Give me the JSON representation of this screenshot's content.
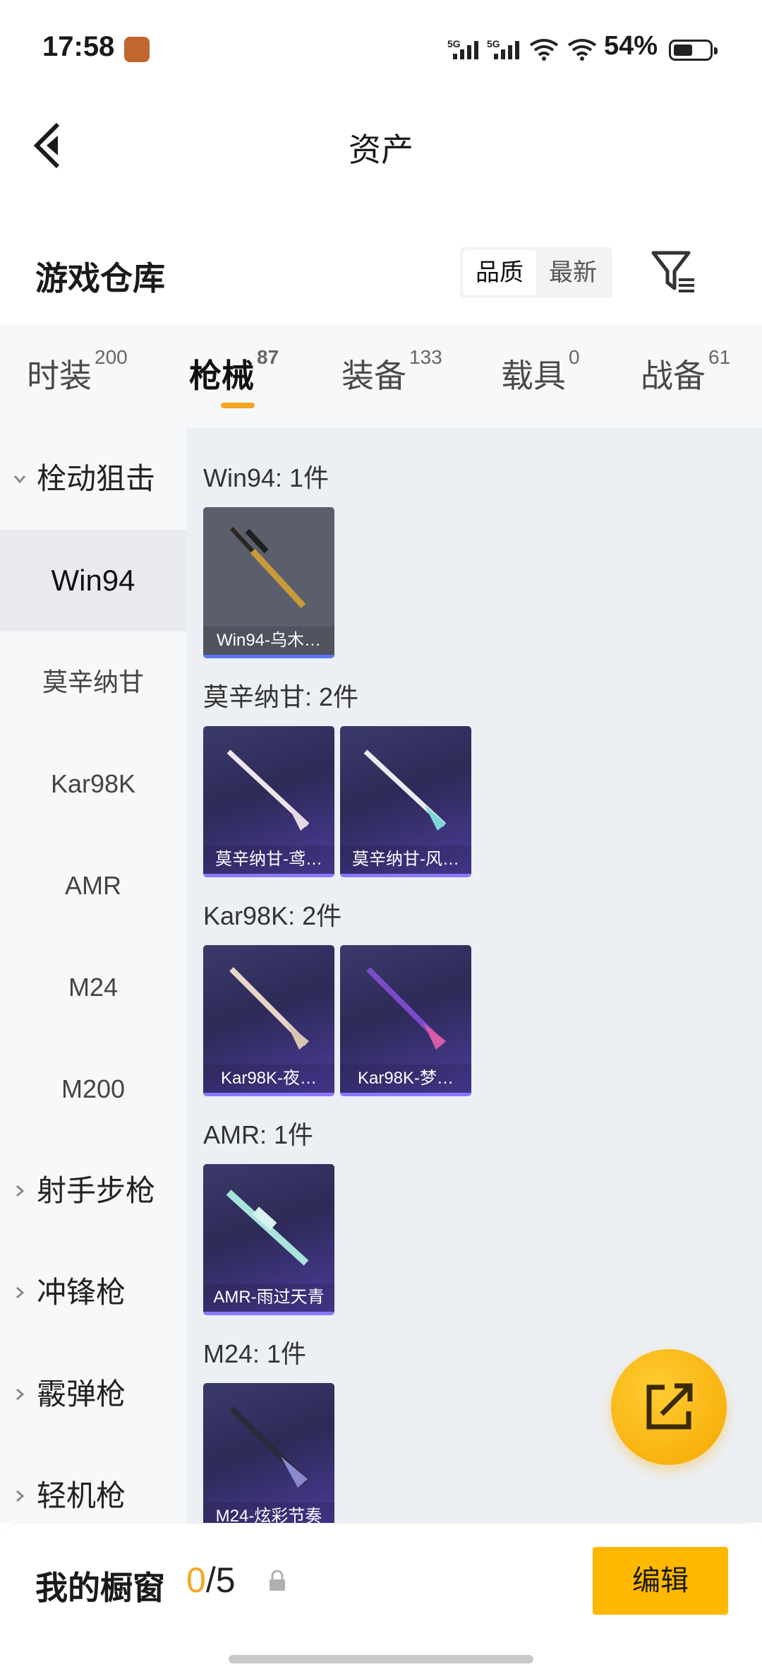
{
  "status_bar": {
    "time": "17:58",
    "net1": "5G",
    "net2": "5G",
    "battery": "54%"
  },
  "header": {
    "title": "资产"
  },
  "warehouse": {
    "title": "游戏仓库",
    "sort_quality": "品质",
    "sort_latest": "最新"
  },
  "tabs": [
    {
      "label": "时装",
      "count": "200"
    },
    {
      "label": "枪械",
      "count": "87"
    },
    {
      "label": "装备",
      "count": "133"
    },
    {
      "label": "载具",
      "count": "0"
    },
    {
      "label": "战备",
      "count": "61"
    }
  ],
  "sidebar": {
    "group_open": "栓动狙击",
    "items": [
      "Win94",
      "莫辛纳甘",
      "Kar98K",
      "AMR",
      "M24",
      "M200"
    ],
    "groups": [
      "射手步枪",
      "冲锋枪",
      "霰弹枪",
      "轻机枪"
    ]
  },
  "groups": [
    {
      "label": "Win94: 1件",
      "cards": [
        "Win94-乌木…"
      ]
    },
    {
      "label": "莫辛纳甘: 2件",
      "cards": [
        "莫辛纳甘-鸢…",
        "莫辛纳甘-风…"
      ]
    },
    {
      "label": "Kar98K: 2件",
      "cards": [
        "Kar98K-夜…",
        "Kar98K-梦…"
      ]
    },
    {
      "label": "AMR: 1件",
      "cards": [
        "AMR-雨过天青"
      ]
    },
    {
      "label": "M24: 1件",
      "cards": [
        "M24-炫彩节奏"
      ]
    }
  ],
  "showcase": {
    "label": "我的橱窗",
    "current": "0",
    "total": "/5",
    "edit": "编辑"
  },
  "icons": {
    "back": "back-arrow-icon",
    "filter": "filter-icon",
    "share": "share-icon",
    "lock": "lock-icon"
  },
  "colors": {
    "accent": "#f5a623",
    "button": "#ffb800",
    "card_gray": "#5a5f6b",
    "card_purple": "#3a3a6a"
  }
}
